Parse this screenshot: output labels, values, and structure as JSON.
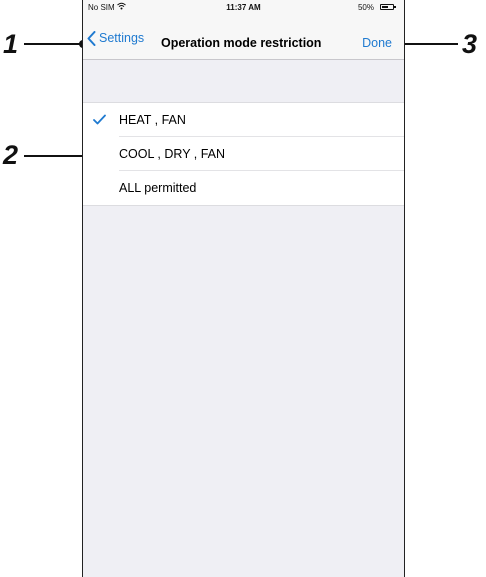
{
  "status_bar": {
    "carrier": "No SIM",
    "time": "11:37 AM",
    "battery_percent": "50%",
    "wifi_icon": "wifi-icon",
    "battery_icon": "battery-icon"
  },
  "nav": {
    "back_label": "Settings",
    "back_icon": "chevron-left-icon",
    "title": "Operation mode restriction",
    "done_label": "Done"
  },
  "options": [
    {
      "label": "HEAT , FAN",
      "selected": true
    },
    {
      "label": "COOL , DRY , FAN",
      "selected": false
    },
    {
      "label": "ALL permitted",
      "selected": false
    }
  ],
  "callouts": {
    "one": "1",
    "two": "2",
    "three": "3"
  },
  "colors": {
    "accent": "#1f7ad0",
    "background": "#efeff4"
  }
}
